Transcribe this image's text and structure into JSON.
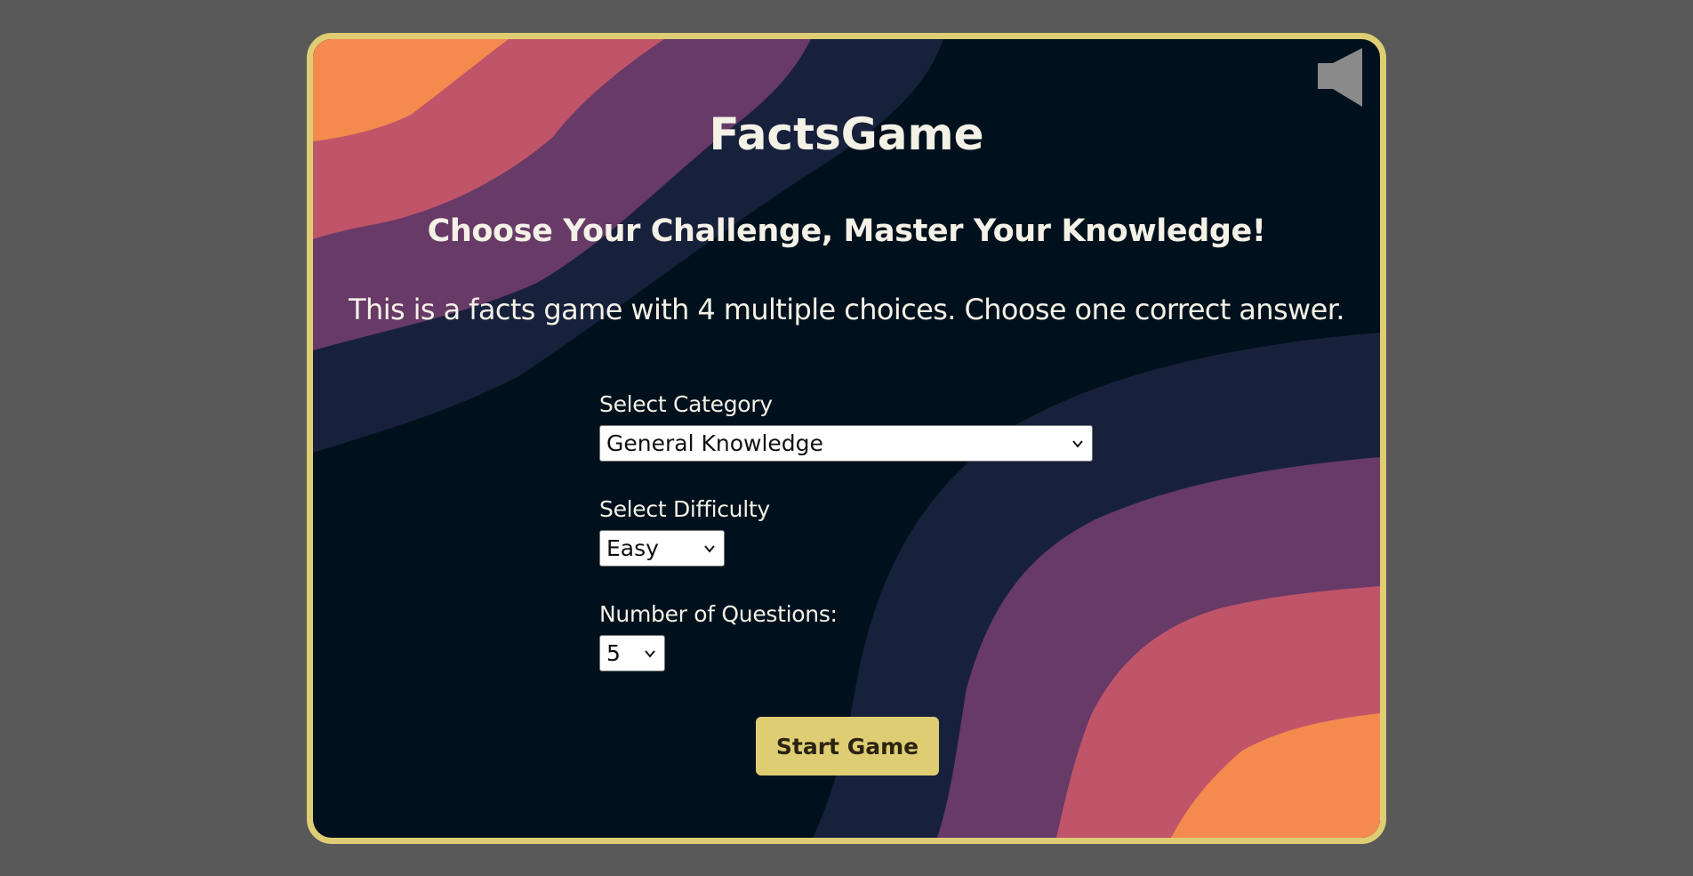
{
  "app": {
    "title": "FactsGame",
    "subtitle": "Choose Your Challenge, Master Your Knowledge!",
    "description": "This is a facts game with 4 multiple choices. Choose one correct answer."
  },
  "settings": {
    "category_label": "Select Category",
    "category_value": "General Knowledge",
    "difficulty_label": "Select Difficulty",
    "difficulty_value": "Easy",
    "questions_label": "Number of Questions:",
    "questions_value": "5"
  },
  "actions": {
    "start_label": "Start Game"
  },
  "icons": {
    "sound": "speaker-muted-icon",
    "dropdown": "chevron-down-icon"
  },
  "colors": {
    "page_background": "#595959",
    "card_background": "#00111d",
    "card_border": "#dfcd74",
    "accent": "#dfcd74",
    "text": "#f4f1e6",
    "wave_orange": "#f48a4e",
    "wave_pink": "#c05469",
    "wave_purple": "#673a67",
    "wave_navy": "#18213c"
  }
}
